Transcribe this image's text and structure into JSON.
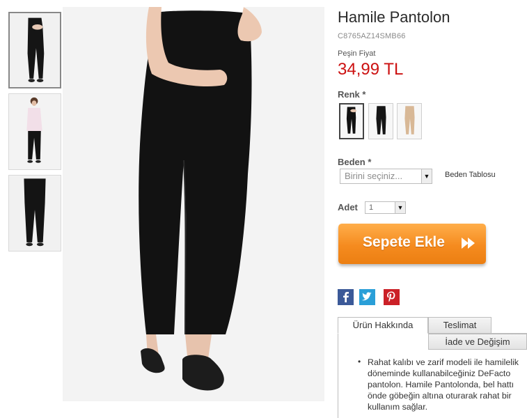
{
  "product": {
    "title": "Hamile Pantolon",
    "sku": "C8765AZ14SMB66",
    "price_label": "Peşin Fiyat",
    "price": "34,99 TL"
  },
  "color": {
    "label": "Renk *",
    "swatches": [
      "black-front",
      "black-side",
      "beige"
    ]
  },
  "size": {
    "label": "Beden *",
    "placeholder": "Birini seçiniz...",
    "table_link": "Beden Tablosu"
  },
  "quantity": {
    "label": "Adet",
    "value": "1"
  },
  "cart": {
    "button_label": "Sepete Ekle"
  },
  "social": [
    "facebook-icon",
    "twitter-icon",
    "pinterest-icon"
  ],
  "tabs": [
    {
      "label": "Ürün Hakkında"
    },
    {
      "label": "Teslimat"
    },
    {
      "label": "İade ve Değişim"
    }
  ],
  "description": "Rahat kalıbı ve zarif modeli ile hamilelik döneminde kullanabilceğiniz DeFacto pantolon. Hamile Pantolonda, bel hattı önde göbeğin altına oturarak rahat bir kullanım sağlar.",
  "colors": {
    "price": "#cc1111",
    "cart_button": "#f58b1f",
    "facebook": "#3b5998",
    "twitter": "#2a9fd8",
    "pinterest": "#cb2027"
  }
}
